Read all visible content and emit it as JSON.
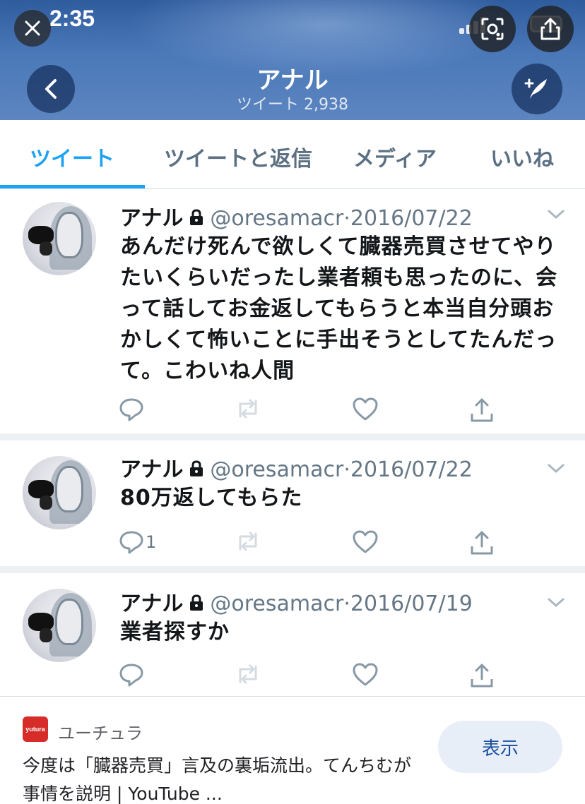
{
  "status": {
    "time": "2:35"
  },
  "header": {
    "name": "アナル",
    "subtitle": "ツイート 2,938"
  },
  "tabs": [
    {
      "label": "ツイート",
      "active": true
    },
    {
      "label": "ツイートと返信",
      "active": false
    },
    {
      "label": "メディア",
      "active": false
    },
    {
      "label": "いいね",
      "active": false
    }
  ],
  "tweets": [
    {
      "name": "アナル",
      "handle": "@oresamacr",
      "dot": "·",
      "date": "2016/07/22",
      "text": "あんだけ死んで欲しくて臓器売買させてやりたいくらいだったし業者頼も思ったのに、会って話してお金返してもらうと本当自分頭おかしくて怖いことに手出そうとしてたんだって。こわいね人間",
      "reply_count": ""
    },
    {
      "name": "アナル",
      "handle": "@oresamacr",
      "dot": "·",
      "date": "2016/07/22",
      "text": "80万返してもらた",
      "reply_count": "1"
    },
    {
      "name": "アナル",
      "handle": "@oresamacr",
      "dot": "·",
      "date": "2016/07/19",
      "text": "業者探すか",
      "reply_count": ""
    }
  ],
  "source_card": {
    "logo_text": "yutura",
    "site_name": "ユーチュラ",
    "title": "今度は「臓器売買」言及の裏垢流出。てんちむが事情を説明 | YouTube ...",
    "button_label": "表示"
  },
  "colors": {
    "accent": "#1da1f2",
    "header": "#4a78b8",
    "muted": "#657786",
    "logo": "#d62d2a"
  }
}
